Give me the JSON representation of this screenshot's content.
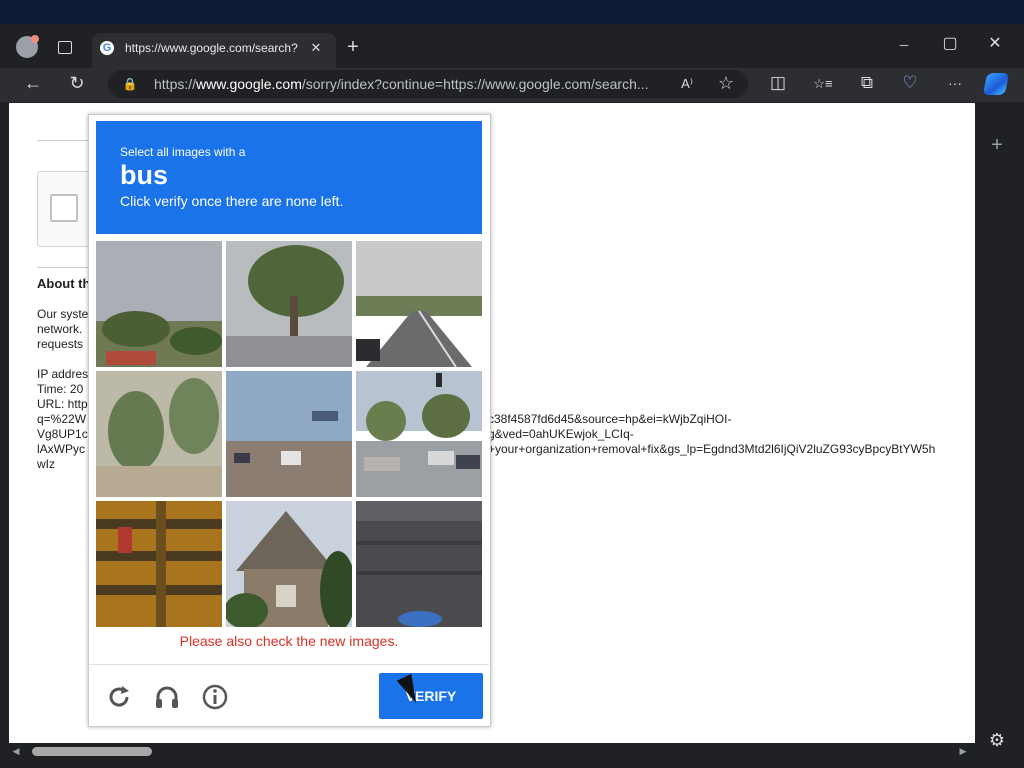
{
  "browser": {
    "tab_title": "https://www.google.com/search?",
    "url_prefix": "https://",
    "url_host": "www.google.com",
    "url_rest": "/sorry/index?continue=https://www.google.com/search...",
    "icons": {
      "profile": "profile-avatar",
      "tab_actions": "tab-actions-icon",
      "new_tab": "+",
      "minimize": "─",
      "maximize": "▢",
      "close": "✕",
      "back": "←",
      "refresh": "↻",
      "lock": "🔒",
      "read_aloud": "A⁾",
      "favorite": "☆",
      "split": "◫",
      "favorites": "☆≡",
      "collections": "⧉",
      "performance": "♡",
      "more": "···",
      "copilot": "copilot-icon",
      "sidebar_add": "+",
      "sidebar_settings": "⚙"
    }
  },
  "page": {
    "about_heading": "About th",
    "para_lines": [
      "Our syste",
      "network.",
      "requests"
    ],
    "info_lines": [
      "IP addres",
      "Time: 20",
      "URL: http",
      "q=%22W",
      "Vg8UP1c",
      "lAxWPyc",
      "wIz"
    ],
    "url_tail_lines": [
      "c38f4587fd6d45&source=hp&ei=kWjbZqiHOI-",
      "g&ved=0ahUKEwjok_LCIq-",
      "+your+organization+removal+fix&gs_lp=Egdnd3Mtd2l6IjQiV2luZG93cyBpcyBtYW5h"
    ]
  },
  "captcha": {
    "select_text": "Select all images with a",
    "target_word": "bus",
    "instruction": "Click verify once there are none left.",
    "notice": "Please also check the new images.",
    "verify_label": "VERIFY",
    "tiles": [
      "tile-trees-field",
      "tile-tree-road",
      "tile-highway",
      "tile-bushes",
      "tile-street-cars",
      "tile-intersection",
      "tile-school-bus",
      "tile-house",
      "tile-dark-vehicle"
    ]
  }
}
